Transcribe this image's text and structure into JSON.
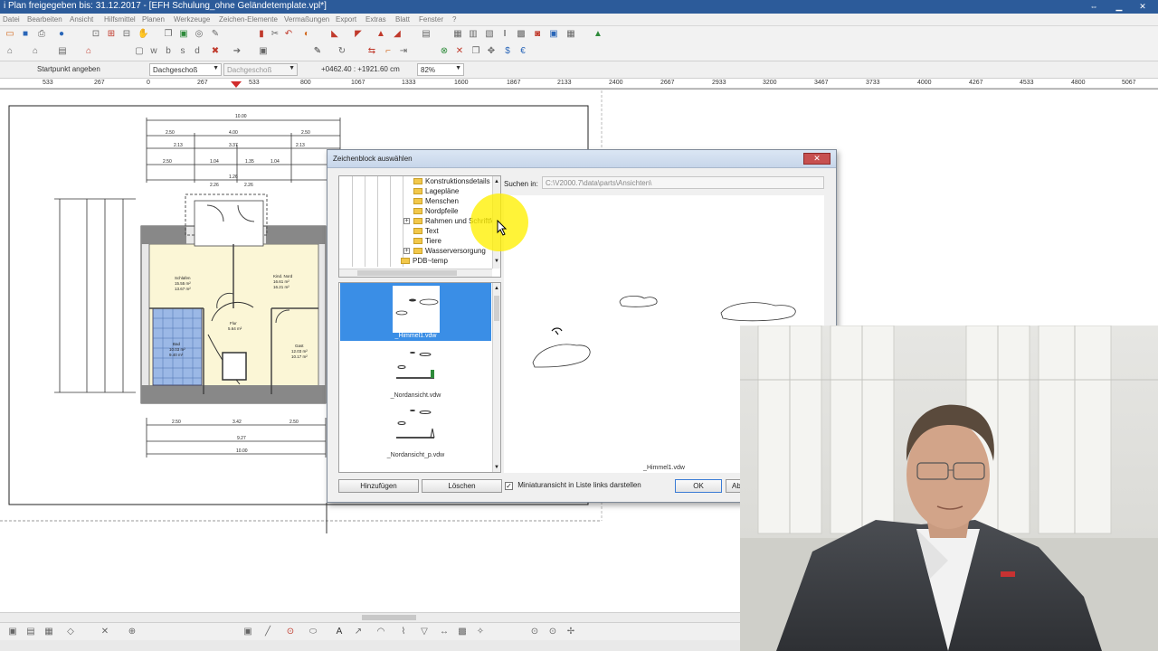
{
  "window": {
    "title": "i Plan freigegeben bis: 31.12.2017 - [EFH Schulung_ohne Geländetemplate.vpl*]"
  },
  "menu": [
    "Datei",
    "Bearbeiten",
    "Ansicht",
    "Hilfsmittel",
    "Planen",
    "Werkzeuge",
    "Zeichen-Elemente",
    "Vermaßungen",
    "Export",
    "Extras",
    "Blatt",
    "Fenster",
    "?"
  ],
  "input_row": {
    "prompt": "Startpunkt angeben",
    "floor_selected": "Dachgeschoß",
    "floor_reference": "Dachgeschoß",
    "coordinates": "+0462.40 : +1921.60 cm",
    "zoom": "82%"
  },
  "ruler": [
    "533",
    "267",
    "0",
    "267",
    "533",
    "800",
    "1067",
    "1333",
    "1600",
    "1867",
    "2133",
    "2400",
    "2667",
    "2933",
    "3200",
    "3467",
    "3733",
    "4000",
    "4267",
    "4533",
    "4800",
    "5067"
  ],
  "plan": {
    "top_dims": [
      "10.00",
      "2.50",
      "4.00",
      "2.50",
      "2.13",
      "3.37",
      "2.13",
      "2.50",
      "1.04",
      "1.35",
      "1.04",
      "2.26",
      "1.26",
      "2.26"
    ],
    "bottom_dims": [
      "2.50",
      "3.42",
      "2.50",
      "9.27",
      "10.00"
    ],
    "rooms": [
      {
        "name": "Schlafen",
        "area": "15.55 m²",
        "area2": "13.67 m²"
      },
      {
        "name": "Kind. Nord",
        "area": "16.61 m²",
        "area2": "16.21 m²"
      },
      {
        "name": "Flur",
        "area": "5.64 m²"
      },
      {
        "name": "Bad",
        "area": "10.03 m²",
        "area2": "9.40 m²"
      },
      {
        "name": "Gast",
        "area": "12.03 m²",
        "area2": "10.17 m²"
      }
    ]
  },
  "dialog": {
    "title": "Zeichenblock auswählen",
    "close": "✕",
    "tree": [
      "Konstruktionsdetails",
      "Lagepläne",
      "Menschen",
      "Nordpfeile",
      "Rahmen und Schriftfelder",
      "Text",
      "Tiere",
      "Wasserversorgung",
      "PDB~temp"
    ],
    "search_label": "Suchen in:",
    "search_path": "C:\\V2000.7\\data\\parts\\Ansichten\\",
    "list": [
      "_Himmel1.vdw",
      "_Nordansicht.vdw",
      "_Nordansicht_p.vdw"
    ],
    "preview_caption": "_Himmel1.vdw",
    "buttons": {
      "add": "Hinzufügen",
      "delete": "Löschen",
      "ok": "OK",
      "cancel": "Ab"
    },
    "checkbox_label": "Miniaturansicht in Liste links darstellen",
    "checkbox_checked": true
  },
  "colors": {
    "titlebar": "#2c5b9a",
    "selection": "#3a8ee6",
    "highlight": "#fff000"
  }
}
